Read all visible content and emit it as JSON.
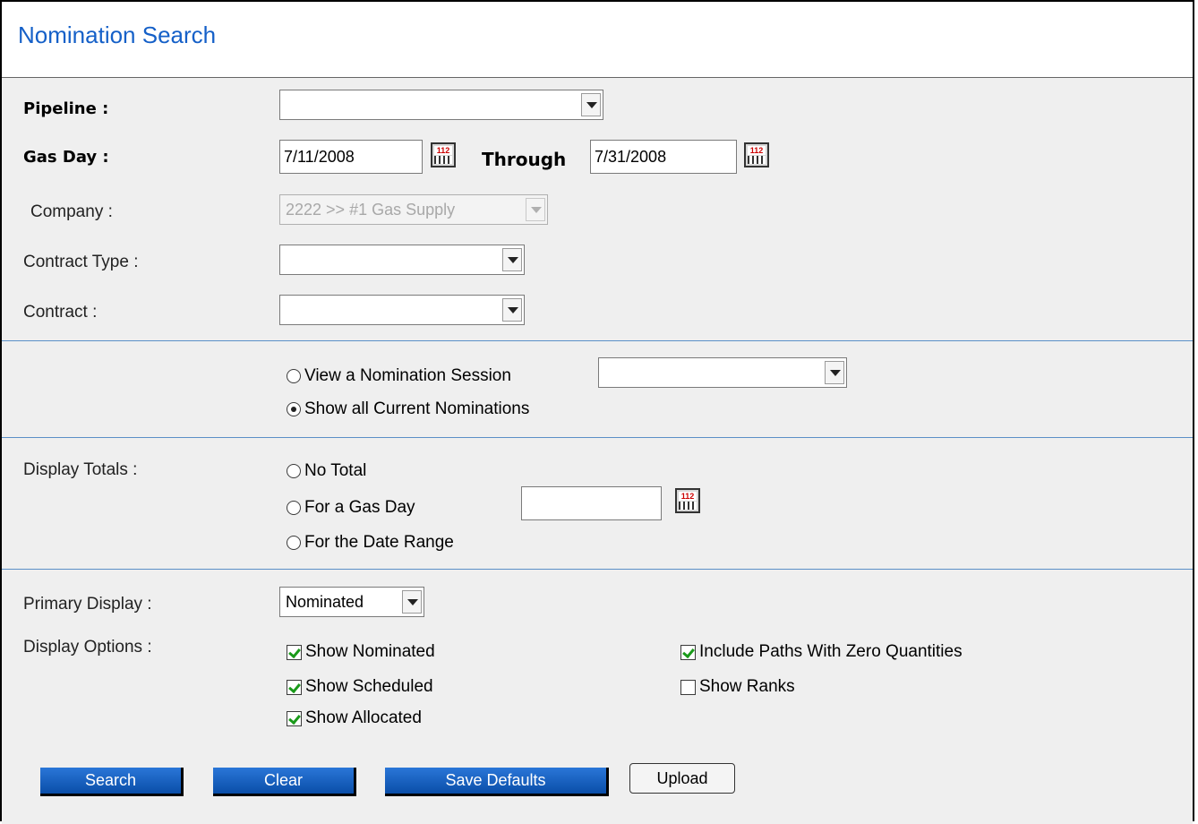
{
  "page": {
    "title": "Nomination Search"
  },
  "fields": {
    "pipeline_label": "Pipeline :",
    "pipeline_value": "",
    "gas_day_label": "Gas Day :",
    "gas_day_from": "7/11/2008",
    "through_label": "Through",
    "gas_day_to": "7/31/2008",
    "company_label": "Company :",
    "company_value": "2222 >> #1 Gas Supply",
    "contract_type_label": "Contract Type :",
    "contract_type_value": "",
    "contract_label": "Contract :",
    "contract_value": ""
  },
  "session": {
    "view_session_label": "View a Nomination Session",
    "session_value": "",
    "show_current_label": "Show all Current Nominations",
    "selected": "show_current"
  },
  "totals": {
    "label": "Display Totals :",
    "no_total": "No Total",
    "gas_day": "For a Gas Day",
    "gas_day_value": "",
    "date_range": "For the Date Range"
  },
  "display": {
    "primary_label": "Primary Display :",
    "primary_value": "Nominated",
    "options_label": "Display Options :",
    "options": [
      {
        "label": "Show Nominated",
        "checked": true
      },
      {
        "label": "Show Scheduled",
        "checked": true
      },
      {
        "label": "Show Allocated",
        "checked": true
      },
      {
        "label": "Include Paths With Zero Quantities",
        "checked": true
      },
      {
        "label": "Show Ranks",
        "checked": false
      }
    ]
  },
  "buttons": {
    "search": "Search",
    "clear": "Clear",
    "save_defaults": "Save Defaults",
    "upload": "Upload"
  },
  "colors": {
    "title": "#1560c8",
    "button": "#0a4ea8",
    "divider": "#5b8fc7",
    "form_bg": "#efefef"
  }
}
